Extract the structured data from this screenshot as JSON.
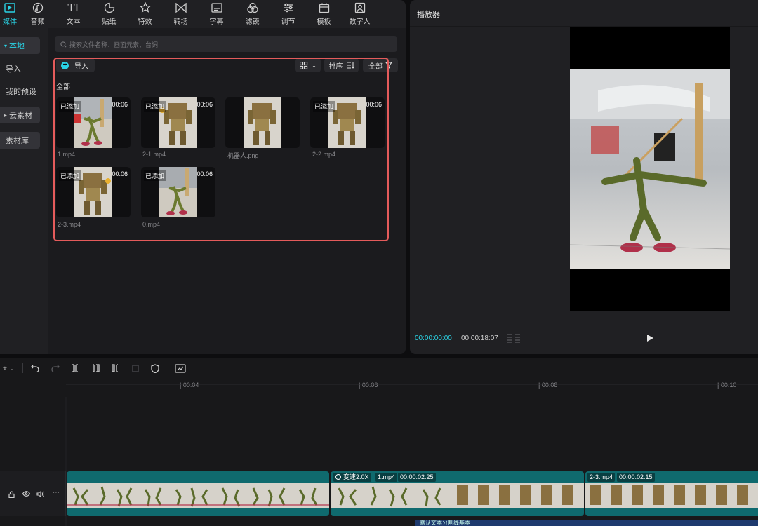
{
  "toolbar": {
    "items": [
      {
        "label": "媒体",
        "icon": "media-icon"
      },
      {
        "label": "音频",
        "icon": "audio-icon"
      },
      {
        "label": "文本",
        "icon": "text-icon"
      },
      {
        "label": "贴纸",
        "icon": "sticker-icon"
      },
      {
        "label": "特效",
        "icon": "effects-icon"
      },
      {
        "label": "转场",
        "icon": "transition-icon"
      },
      {
        "label": "字幕",
        "icon": "subtitle-icon"
      },
      {
        "label": "滤镜",
        "icon": "filter-icon"
      },
      {
        "label": "调节",
        "icon": "adjust-icon"
      },
      {
        "label": "模板",
        "icon": "template-icon"
      },
      {
        "label": "数字人",
        "icon": "digital-human-icon"
      }
    ],
    "accent": "#2ad4e6"
  },
  "sidenav": {
    "items": [
      {
        "label": "本地"
      },
      {
        "label": "导入"
      },
      {
        "label": "我的预设"
      },
      {
        "label": "云素材"
      },
      {
        "label": "素材库"
      }
    ]
  },
  "media": {
    "search_placeholder": "搜索文件名称、画面元素、台词",
    "import_label": "导入",
    "sort_label": "排序",
    "filter_label": "全部",
    "section_label": "全部",
    "added_badge": "已添加",
    "cards": [
      {
        "name": "1.mp4",
        "duration": "00:06",
        "added": true
      },
      {
        "name": "2-1.mp4",
        "duration": "00:06",
        "added": true
      },
      {
        "name": "机器人.png",
        "duration": "",
        "added": false
      },
      {
        "name": "2-2.mp4",
        "duration": "00:06",
        "added": true
      },
      {
        "name": "2-3.mp4",
        "duration": "00:06",
        "added": true
      },
      {
        "name": "0.mp4",
        "duration": "00:06",
        "added": true
      }
    ]
  },
  "player": {
    "title": "播放器",
    "current_time": "00:00:00:00",
    "total_time": "00:00:18:07"
  },
  "timeline": {
    "ticks": [
      "| 00:04",
      "| 00:06",
      "| 00:08",
      "| 00:10"
    ],
    "clips": [
      {
        "speed": "变速2.0X",
        "name": "1.mp4",
        "duration": "00:00:02:25"
      },
      {
        "name": "2-3.mp4",
        "duration": "00:00:02:15"
      }
    ],
    "bottom_clip_text": "默认文本分割线基本"
  }
}
